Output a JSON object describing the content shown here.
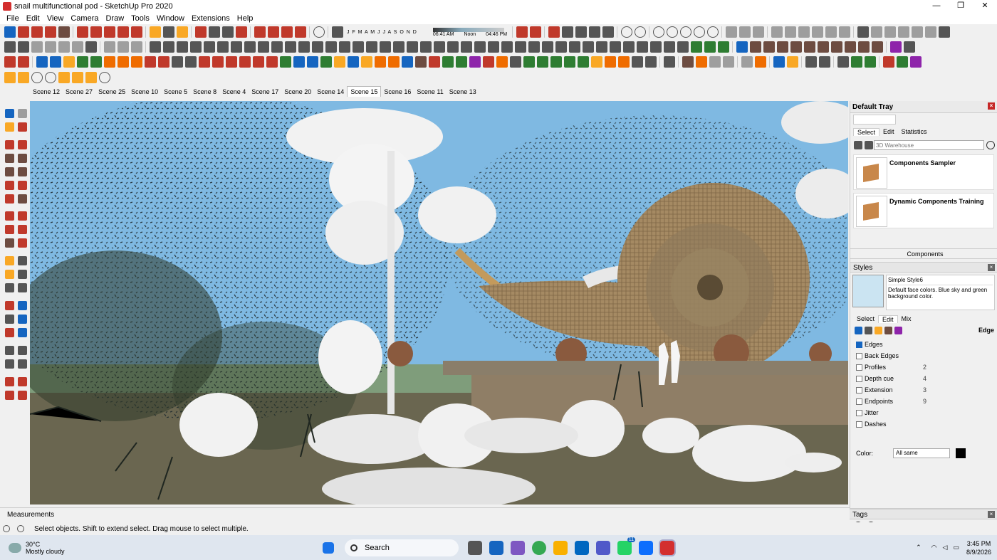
{
  "window": {
    "title": "snail multifunctional pod - SketchUp Pro 2020",
    "minimize": "—",
    "maximize": "❐",
    "close": "✕"
  },
  "menu": [
    "File",
    "Edit",
    "View",
    "Camera",
    "Draw",
    "Tools",
    "Window",
    "Extensions",
    "Help"
  ],
  "shadow": {
    "months": "J F M A M J J A S O N D",
    "time_start": "06:41 AM",
    "noon": "Noon",
    "time_end": "04:46 PM"
  },
  "scenes": [
    "Scene 12",
    "Scene 27",
    "Scene 25",
    "Scene 10",
    "Scene 5",
    "Scene 8",
    "Scene 4",
    "Scene 17",
    "Scene 20",
    "Scene 14",
    "Scene 15",
    "Scene 16",
    "Scene 11",
    "Scene 13"
  ],
  "active_scene": "Scene 15",
  "tray": {
    "title": "Default Tray",
    "components_tabs": [
      "Select",
      "Edit",
      "Statistics"
    ],
    "search_placeholder": "3D Warehouse",
    "collections": [
      "Components Sampler",
      "Dynamic Components Training"
    ],
    "components_label": "Components",
    "styles_title": "Styles",
    "style_name": "Simple Style6",
    "style_desc": "Default face colors. Blue sky and green background color.",
    "style_tabs": [
      "Select",
      "Edit",
      "Mix"
    ],
    "edge_label": "Edge",
    "edge_settings": [
      {
        "label": "Edges",
        "checked": true,
        "value": ""
      },
      {
        "label": "Back Edges",
        "checked": false,
        "value": ""
      },
      {
        "label": "Profiles",
        "checked": false,
        "value": "2"
      },
      {
        "label": "Depth cue",
        "checked": false,
        "value": "4"
      },
      {
        "label": "Extension",
        "checked": false,
        "value": "3"
      },
      {
        "label": "Endpoints",
        "checked": false,
        "value": "9"
      },
      {
        "label": "Jitter",
        "checked": false,
        "value": ""
      },
      {
        "label": "Dashes",
        "checked": false,
        "value": ""
      }
    ],
    "color_label": "Color:",
    "color_value": "All same",
    "tags_title": "Tags"
  },
  "measurements_label": "Measurements",
  "status_text": "Select objects. Shift to extend select. Drag mouse to select multiple.",
  "taskbar": {
    "temp": "30°C",
    "weather": "Mostly cloudy",
    "search": "Search",
    "time": "3:45 PM",
    "date": "8/9/2026",
    "badge": "11"
  },
  "colors": {
    "sky": "#7db7e0",
    "accent": "#1565c0"
  }
}
